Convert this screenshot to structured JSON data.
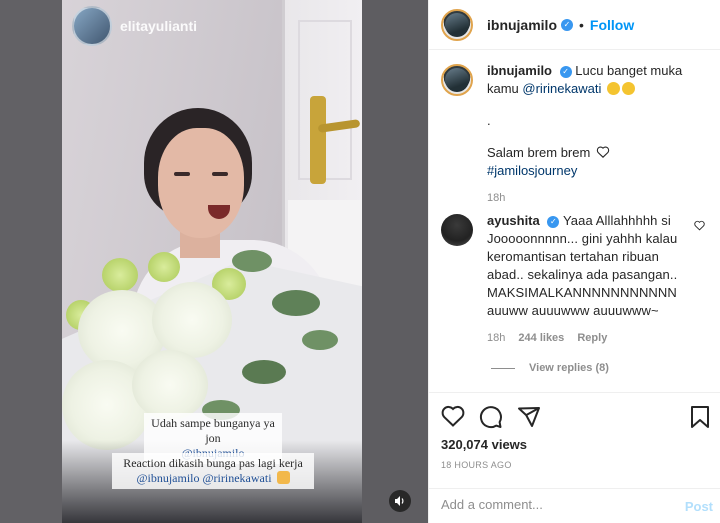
{
  "story": {
    "username": "elitayulianti",
    "caption_1_line1": "Udah sampe bunganya ya jon",
    "caption_1_line2": "@ibnujamilo",
    "caption_2_line1": "Reaction dikasih bunga pas lagi kerja",
    "caption_2_line2": "@ibnujamilo @ririnekawati"
  },
  "header": {
    "username": "ibnujamilo",
    "separator": "•",
    "follow_label": "Follow"
  },
  "post_caption": {
    "username": "ibnujamilo",
    "text_before_mention": "Lucu banget muka kamu ",
    "mention": "@ririnekawati",
    "line_dot": ".",
    "line_salam": "Salam brem brem",
    "hashtag": "#jamilosjourney",
    "age": "18h"
  },
  "comment": {
    "username": "ayushita",
    "text": "Yaaa Alllahhhhh si Jooooonnnnn... gini yahhh kalau keromantisan tertahan ribuan abad.. sekalinya ada pasangan.. MAKSIMALKANNNNNNNNNNN auuww auuuwww auuuwww~",
    "age": "18h",
    "likes": "244 likes",
    "reply_label": "Reply",
    "view_replies": "View replies (8)"
  },
  "stats": {
    "views": "320,074 views",
    "timestamp": "18 HOURS AGO"
  },
  "add_comment": {
    "placeholder": "Add a comment...",
    "post_label": "Post"
  },
  "colors": {
    "follow": "#0095f6",
    "verified": "#3897f0",
    "post_disabled": "#b2dffc",
    "link": "#00376b"
  }
}
